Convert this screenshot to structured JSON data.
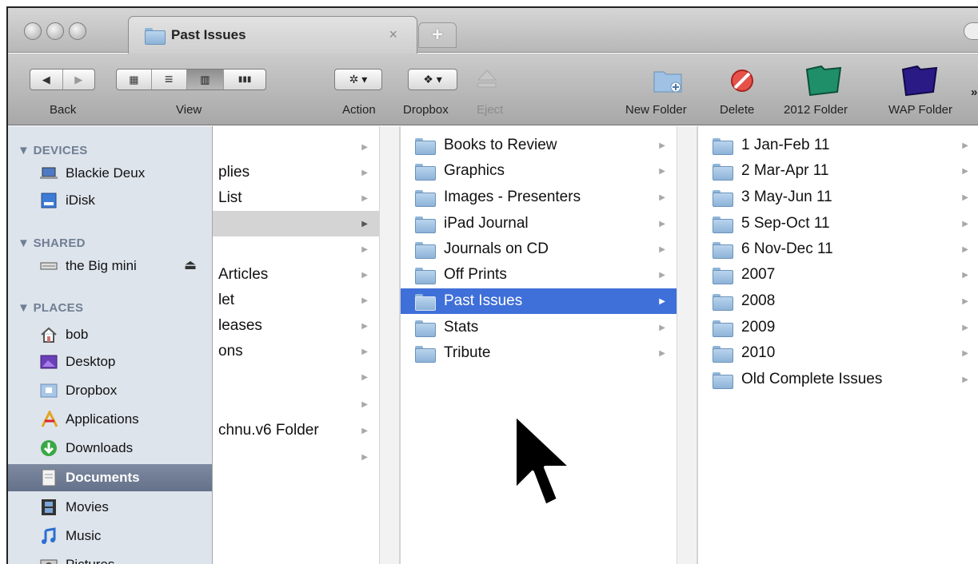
{
  "window": {
    "tab_title": "Past Issues",
    "tab_close": "×",
    "new_tab": "+"
  },
  "toolbar": {
    "back_label": "Back",
    "view_label": "View",
    "action_label": "Action",
    "dropbox_label": "Dropbox",
    "eject_label": "Eject",
    "new_folder_label": "New Folder",
    "delete_label": "Delete",
    "folder2012_label": "2012 Folder",
    "wap_folder_label": "WAP Folder",
    "overflow": "»",
    "back_glyph": "◀",
    "forward_glyph": "▶",
    "icon_view_glyph": "▦",
    "list_view_glyph": "≡",
    "column_view_glyph": "▥",
    "coverflow_glyph": "▮▮▮",
    "action_glyph": "✲ ▾",
    "dropbox_glyph": "❖ ▾",
    "colors": {
      "folder2012": "#1f8f6a",
      "wap": "#2a1a86",
      "delete": "#d93a2e"
    }
  },
  "sidebar": {
    "devices_header": "▼ DEVICES",
    "devices": [
      {
        "label": "Blackie Deux",
        "icon": "laptop-icon"
      },
      {
        "label": "iDisk",
        "icon": "idisk-icon"
      }
    ],
    "shared_header": "▼ SHARED",
    "shared": [
      {
        "label": "the Big mini",
        "icon": "display-icon",
        "eject": "⏏"
      }
    ],
    "places_header": "▼ PLACES",
    "places": [
      {
        "label": "bob",
        "icon": "home-icon"
      },
      {
        "label": "Desktop",
        "icon": "desktop-icon"
      },
      {
        "label": "Dropbox",
        "icon": "dropbox-icon"
      },
      {
        "label": "Applications",
        "icon": "applications-icon"
      },
      {
        "label": "Downloads",
        "icon": "downloads-icon"
      },
      {
        "label": "Documents",
        "icon": "documents-icon",
        "selected": true
      },
      {
        "label": "Movies",
        "icon": "movies-icon"
      },
      {
        "label": "Music",
        "icon": "music-icon"
      },
      {
        "label": "Pictures",
        "icon": "pictures-icon"
      }
    ]
  },
  "column1": {
    "items": [
      "",
      "plies",
      "List",
      "",
      "",
      "Articles",
      "let",
      "leases",
      "ons",
      "",
      "",
      "chnu.v6 Folder",
      ""
    ],
    "arrow": "▶"
  },
  "column2": {
    "items": [
      "Books to Review",
      "Graphics",
      "Images - Presenters",
      "iPad Journal",
      "Journals on CD",
      "Off Prints",
      "Past Issues",
      "Stats",
      "Tribute"
    ],
    "selected_index": 6
  },
  "column3": {
    "items": [
      "1 Jan-Feb 11",
      "2 Mar-Apr 11",
      "3 May-Jun 11",
      "5 Sep-Oct 11",
      "6 Nov-Dec 11",
      "2007",
      "2008",
      "2009",
      "2010",
      "Old Complete Issues"
    ]
  }
}
